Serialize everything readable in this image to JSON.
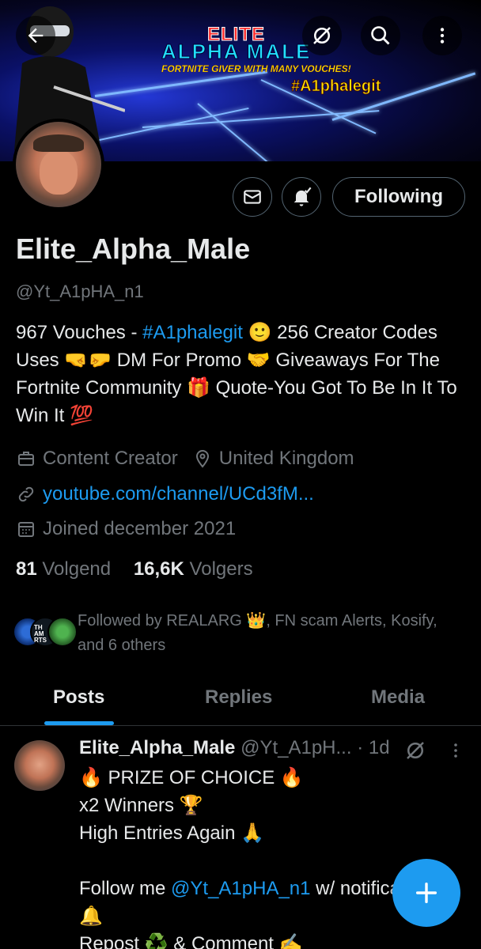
{
  "banner": {
    "title_line1": "ELITE",
    "title_line2": "ALPHA MALE",
    "subtitle": "FORTNITE GIVER WITH MANY VOUCHES!",
    "hashtag": "#A1phalegit"
  },
  "toolbar": {
    "back_icon": "arrow-left-icon",
    "grok_icon": "grok-icon",
    "search_icon": "search-icon",
    "more_icon": "more-vertical-icon"
  },
  "actions": {
    "message_icon": "envelope-icon",
    "notify_icon": "bell-check-icon",
    "follow_label": "Following"
  },
  "profile": {
    "name": "Elite_Alpha_Male",
    "handle": "@Yt_A1pHA_n1",
    "bio_part1": "967 Vouches - ",
    "bio_hashtag": "#A1phalegit",
    "bio_part2": " 🙂 256 Creator Codes Uses 🤜🤛 DM For Promo 🤝 Giveaways For The Fortnite Community 🎁 Quote-You Got To Be In It To Win It 💯",
    "category": "Content Creator",
    "location": "United Kingdom",
    "website": "youtube.com/channel/UCd3fM...",
    "joined": "Joined december 2021"
  },
  "stats": {
    "following_count": "81",
    "following_label": "Volgend",
    "followers_count": "16,6K",
    "followers_label": "Volgers"
  },
  "followed_by": {
    "text": "Followed by REALARG 👑, FN scam Alerts, Kosify, and 6 others"
  },
  "tabs": [
    {
      "label": "Posts",
      "active": true
    },
    {
      "label": "Replies",
      "active": false
    },
    {
      "label": "Media",
      "active": false
    }
  ],
  "post": {
    "author_name": "Elite_Alpha_Male",
    "author_handle": "@Yt_A1pH...",
    "time": "· 1d",
    "line1": "🔥 PRIZE OF CHOICE 🔥",
    "line2": "x2 Winners 🏆",
    "line3": "High Entries Again 🙏",
    "line5_prefix": "Follow me ",
    "line5_mention": "@Yt_A1pHA_n1",
    "line5_suffix": " w/ notifications",
    "line6": "🔔",
    "line7": "Repost ♻️ & Comment ✍️"
  },
  "fab": {
    "icon": "plus-icon"
  },
  "colors": {
    "accent": "#1d9bf0",
    "background": "#000000",
    "muted": "#71767b"
  }
}
